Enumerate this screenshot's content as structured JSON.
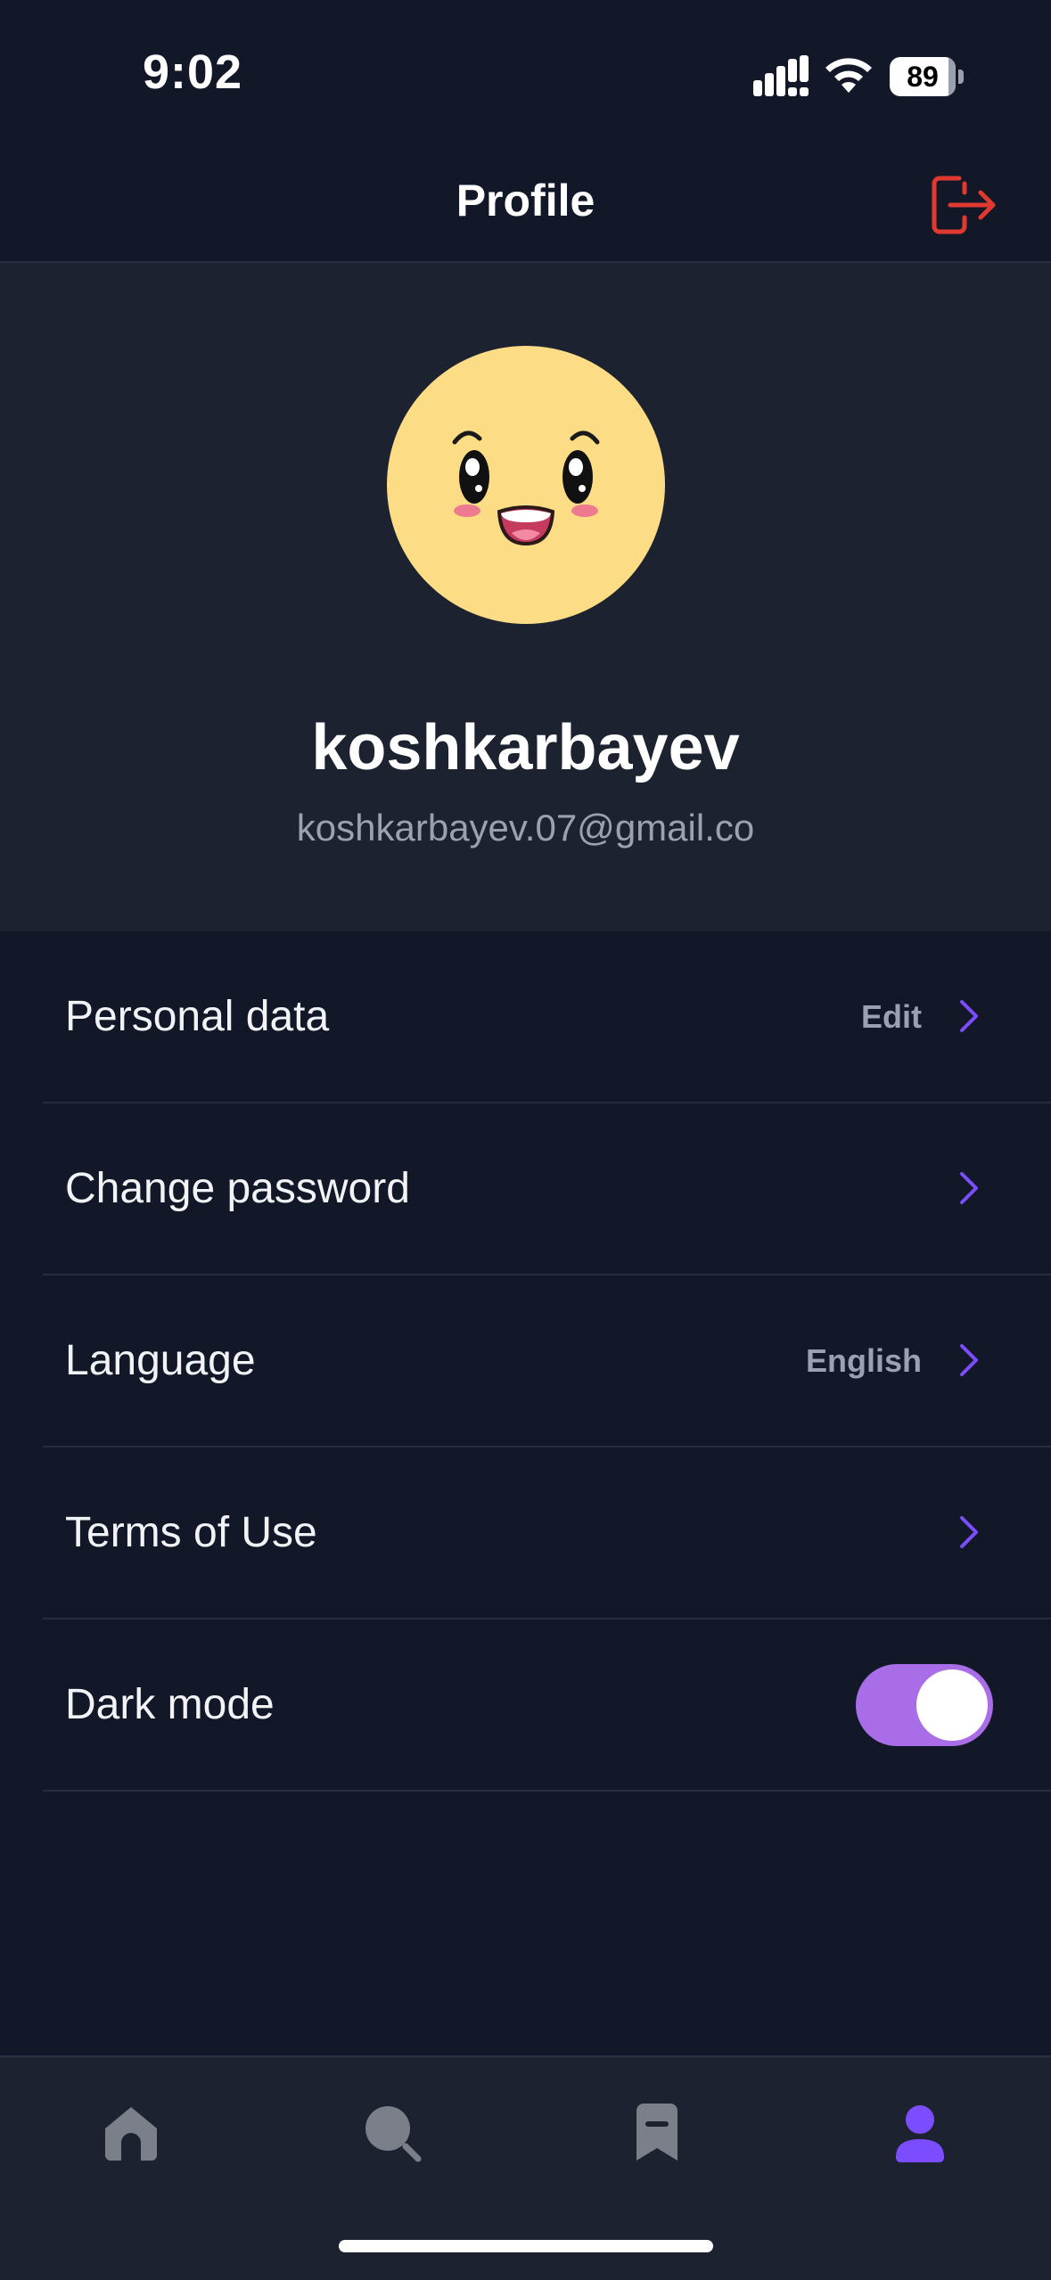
{
  "status_bar": {
    "time": "9:02",
    "battery_level": "89",
    "battery_fraction": 0.89
  },
  "header": {
    "title": "Profile",
    "logout_icon": "logout-icon"
  },
  "profile": {
    "username": "koshkarbayev",
    "email": "koshkarbayev.07@gmail.co",
    "avatar_icon": "smiley-face-avatar"
  },
  "menu": {
    "items": [
      {
        "label": "Personal data",
        "value": "Edit"
      },
      {
        "label": "Change password",
        "value": ""
      },
      {
        "label": "Language",
        "value": "English"
      },
      {
        "label": "Terms of Use",
        "value": ""
      },
      {
        "label": "Dark mode",
        "toggle": true
      }
    ]
  },
  "bottom_nav": {
    "items": [
      {
        "icon": "home-icon",
        "active": false
      },
      {
        "icon": "search-icon",
        "active": false
      },
      {
        "icon": "bookmark-icon",
        "active": false
      },
      {
        "icon": "profile-icon",
        "active": true
      }
    ]
  },
  "colors": {
    "background": "#131829",
    "card": "#1d2230",
    "accent": "#7c4dff",
    "toggle": "#a96de8",
    "logout": "#e0392f",
    "muted_text": "#9aa1b1",
    "inactive_icon": "#7a7f8a"
  }
}
